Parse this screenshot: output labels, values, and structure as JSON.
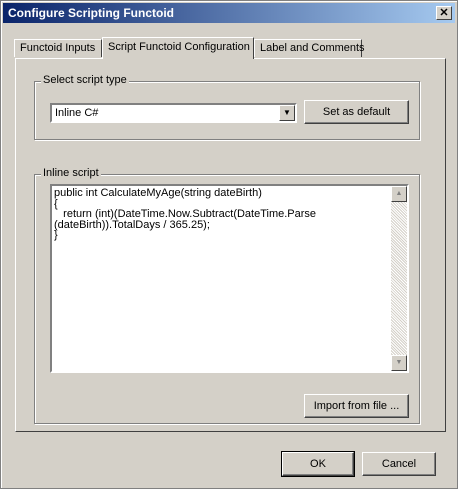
{
  "window": {
    "title": "Configure Scripting Functoid",
    "close_glyph": "✕"
  },
  "tabs": [
    {
      "label": "Functoid Inputs"
    },
    {
      "label": "Script Functoid Configuration"
    },
    {
      "label": "Label and Comments"
    }
  ],
  "script_type": {
    "legend": "Select script type",
    "selected": "Inline C#",
    "set_default_label": "Set as default"
  },
  "inline_script": {
    "legend": "Inline script",
    "code": "public int CalculateMyAge(string dateBirth)\n{\n   return (int)(DateTime.Now.Subtract(DateTime.Parse (dateBirth)).TotalDays / 365.25);\n}",
    "import_label": "Import from file ..."
  },
  "footer": {
    "ok_label": "OK",
    "cancel_label": "Cancel"
  },
  "icons": {
    "dropdown_arrow": "▼",
    "scroll_up": "▲",
    "scroll_down": "▼"
  }
}
